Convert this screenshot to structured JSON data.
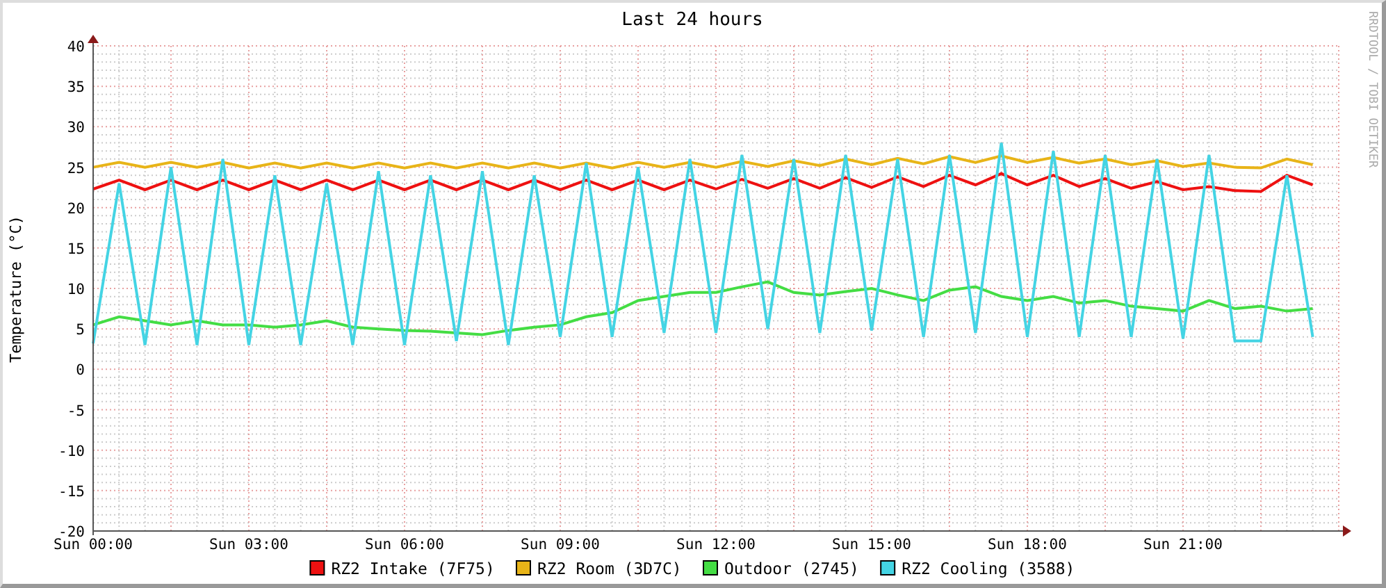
{
  "chart": {
    "side_credit": "RRDTOOL / TOBI OETIKER",
    "chart_data": {
      "type": "line",
      "title": "Last 24 hours",
      "ylabel": "Temperature (°C)",
      "categories": [
        "Sun 00:00",
        null,
        null,
        null,
        null,
        null,
        "Sun 03:00",
        null,
        null,
        null,
        null,
        null,
        "Sun 06:00",
        null,
        null,
        null,
        null,
        null,
        "Sun 09:00",
        null,
        null,
        null,
        null,
        null,
        "Sun 12:00",
        null,
        null,
        null,
        null,
        null,
        "Sun 15:00",
        null,
        null,
        null,
        null,
        null,
        "Sun 18:00",
        null,
        null,
        null,
        null,
        null,
        "Sun 21:00",
        null,
        null,
        null,
        null,
        null
      ],
      "ylim": [
        -20,
        40
      ],
      "grid": true,
      "legend": "bottom",
      "yticks": [
        -20,
        -15,
        -10,
        -5,
        0,
        5,
        10,
        15,
        20,
        25,
        30,
        35,
        40
      ],
      "series": [
        {
          "name": "RZ2 Intake (7F75)",
          "color": "#ee1111",
          "values": [
            22.3,
            23.4,
            22.2,
            23.4,
            22.2,
            23.4,
            22.2,
            23.4,
            22.2,
            23.4,
            22.2,
            23.4,
            22.2,
            23.4,
            22.2,
            23.4,
            22.2,
            23.4,
            22.2,
            23.4,
            22.2,
            23.4,
            22.2,
            23.4,
            22.3,
            23.5,
            22.4,
            23.6,
            22.4,
            23.7,
            22.5,
            23.8,
            22.6,
            24.0,
            22.8,
            24.2,
            22.8,
            24.0,
            22.6,
            23.6,
            22.4,
            23.2,
            22.2,
            22.6,
            22.1,
            22.0,
            24.0,
            22.8
          ]
        },
        {
          "name": "RZ2 Room (3D7C)",
          "color": "#e8b418",
          "values": [
            25.0,
            25.6,
            25.0,
            25.6,
            25.0,
            25.6,
            24.9,
            25.5,
            24.9,
            25.5,
            24.9,
            25.5,
            24.9,
            25.5,
            24.9,
            25.5,
            24.9,
            25.5,
            24.9,
            25.5,
            24.9,
            25.6,
            25.0,
            25.6,
            25.0,
            25.7,
            25.1,
            25.8,
            25.2,
            26.0,
            25.3,
            26.1,
            25.4,
            26.3,
            25.6,
            26.4,
            25.6,
            26.2,
            25.5,
            26.0,
            25.3,
            25.8,
            25.1,
            25.5,
            25.0,
            24.9,
            26.0,
            25.3
          ]
        },
        {
          "name": "Outdoor (2745)",
          "color": "#44dd44",
          "values": [
            5.5,
            6.5,
            6.0,
            5.5,
            6.0,
            5.5,
            5.5,
            5.2,
            5.5,
            6.0,
            5.2,
            5.0,
            4.8,
            4.7,
            4.5,
            4.3,
            4.8,
            5.2,
            5.5,
            6.5,
            7.0,
            8.5,
            9.0,
            9.5,
            9.5,
            10.2,
            10.8,
            9.5,
            9.2,
            9.6,
            10.0,
            9.2,
            8.5,
            9.8,
            10.2,
            9.0,
            8.5,
            9.0,
            8.2,
            8.5,
            7.8,
            7.5,
            7.2,
            8.5,
            7.5,
            7.8,
            7.2,
            7.5
          ]
        },
        {
          "name": "RZ2 Cooling (3588)",
          "color": "#44d4e4",
          "values": [
            3.2,
            23.0,
            3.0,
            25.0,
            3.0,
            26.0,
            3.0,
            24.0,
            3.0,
            23.0,
            3.0,
            24.5,
            3.0,
            24.0,
            3.5,
            24.5,
            3.0,
            24.0,
            4.0,
            25.5,
            4.0,
            25.0,
            4.5,
            26.0,
            4.5,
            26.5,
            5.0,
            26.0,
            4.5,
            26.5,
            4.8,
            26.0,
            4.0,
            26.5,
            4.5,
            28.0,
            4.0,
            27.0,
            4.0,
            26.5,
            4.0,
            26.0,
            3.8,
            26.5,
            3.5,
            3.5,
            24.0,
            4.0
          ]
        }
      ]
    }
  }
}
